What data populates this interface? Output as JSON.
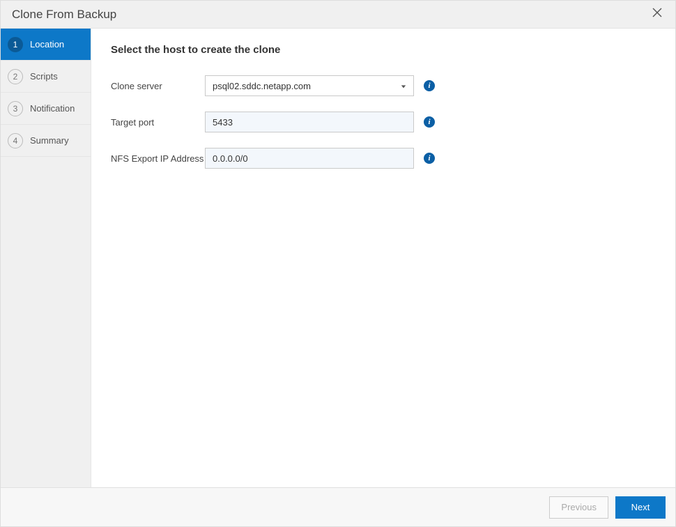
{
  "dialog": {
    "title": "Clone From Backup"
  },
  "steps": [
    {
      "num": "1",
      "label": "Location",
      "active": true
    },
    {
      "num": "2",
      "label": "Scripts",
      "active": false
    },
    {
      "num": "3",
      "label": "Notification",
      "active": false
    },
    {
      "num": "4",
      "label": "Summary",
      "active": false
    }
  ],
  "content": {
    "heading": "Select the host to create the clone",
    "fields": {
      "clone_server": {
        "label": "Clone server",
        "value": "psql02.sddc.netapp.com"
      },
      "target_port": {
        "label": "Target port",
        "value": "5433"
      },
      "nfs_export": {
        "label": "NFS Export IP Address",
        "value": "0.0.0.0/0"
      }
    }
  },
  "footer": {
    "previous": "Previous",
    "next": "Next"
  }
}
